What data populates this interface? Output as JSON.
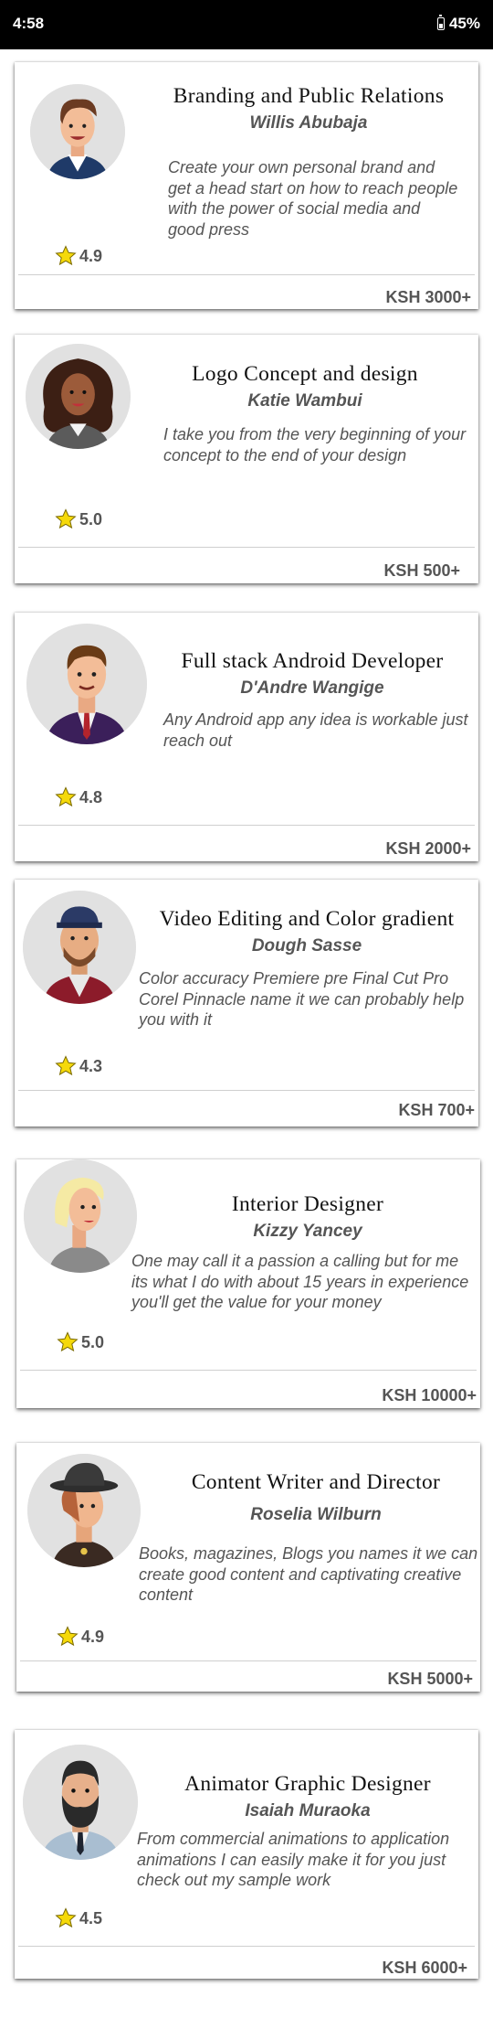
{
  "status_bar": {
    "time": "4:58",
    "battery": "45%"
  },
  "services": [
    {
      "title": "Branding and Public Relations",
      "author": "Willis Abubaja",
      "description": "Create your own personal brand and get a head start on how to reach people with the power of social media and good press",
      "rating": "4.9",
      "price": "KSH 3000+",
      "avatar_icon": "man-brown-quiff-avatar-icon"
    },
    {
      "title": "Logo Concept and design",
      "author": "Katie Wambui",
      "description": "I take you from the very beginning of your concept to the end of your design",
      "rating": "5.0",
      "price": "KSH 500+",
      "avatar_icon": "woman-curly-hair-avatar-icon"
    },
    {
      "title": "Full stack Android Developer",
      "author": "D'Andre Wangige",
      "description": "Any Android app any idea is workable just reach out",
      "rating": "4.8",
      "price": "KSH 2000+",
      "avatar_icon": "man-suit-tie-avatar-icon"
    },
    {
      "title": "Video Editing and Color gradient",
      "author": "Dough Sasse",
      "description": "Color accuracy Premiere pre Final Cut Pro Corel Pinnacle name it we can probably help you with it",
      "rating": "4.3",
      "price": "KSH 700+",
      "avatar_icon": "man-cap-beard-avatar-icon"
    },
    {
      "title": "Interior Designer",
      "author": "Kizzy Yancey",
      "description": "One may call it a passion a calling but for me its what I do with about 15 years in experience you'll get the value for your money",
      "rating": "5.0",
      "price": "KSH 10000+",
      "avatar_icon": "woman-blonde-avatar-icon"
    },
    {
      "title": "Content Writer and Director",
      "author": "Roselia Wilburn",
      "description": "Books, magazines, Blogs you names it we can create good content and captivating creative content",
      "rating": "4.9",
      "price": "KSH 5000+",
      "avatar_icon": "woman-hat-avatar-icon"
    },
    {
      "title": "Animator Graphic Designer",
      "author": "Isaiah Muraoka",
      "description": "From commercial animations to application animations I can easily make it for you just check out my sample work",
      "rating": "4.5",
      "price": "KSH 6000+",
      "avatar_icon": "man-beard-glasses-avatar-icon"
    }
  ],
  "colors": {
    "star": "#f5d90a",
    "text_gray": "#555555",
    "avatar_bg": "#e1e1e1"
  }
}
